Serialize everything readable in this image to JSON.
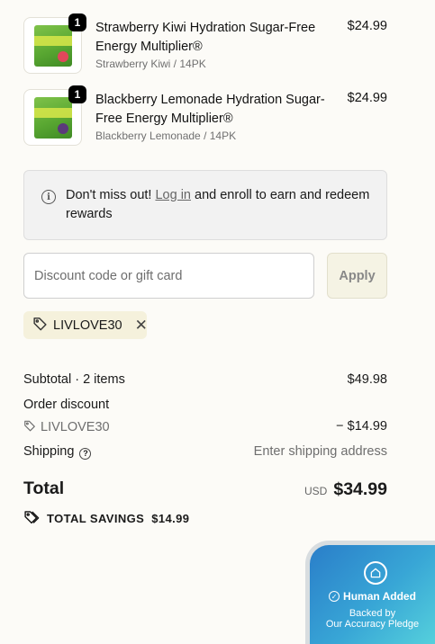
{
  "cart_items": [
    {
      "quantity": "1",
      "name": "Strawberry Kiwi Hydration Sugar-Free Energy Multiplier®",
      "variant": "Strawberry Kiwi / 14PK",
      "price": "$24.99",
      "fruit_color": "#e0475b"
    },
    {
      "quantity": "1",
      "name": "Blackberry Lemonade Hydration Sugar-Free Energy Multiplier®",
      "variant": "Blackberry Lemonade / 14PK",
      "price": "$24.99",
      "fruit_color": "#5b3a7a"
    }
  ],
  "notice": {
    "before": "Don't miss out! ",
    "link": "Log in",
    "after": " and enroll to earn and redeem rewards"
  },
  "discount": {
    "placeholder": "Discount code or gift card",
    "apply_label": "Apply",
    "applied_code": "LIVLOVE30"
  },
  "summary": {
    "subtotal_label": "Subtotal · 2 items",
    "subtotal_value": "$49.98",
    "order_discount_label": "Order discount",
    "discount_code": "LIVLOVE30",
    "discount_value": "− $14.99",
    "shipping_label": "Shipping",
    "shipping_value": "Enter shipping address",
    "total_label": "Total",
    "currency": "USD",
    "total_value": "$34.99",
    "savings_label": "TOTAL SAVINGS",
    "savings_value": "$14.99"
  },
  "badge": {
    "headline": "Human Added",
    "line1": "Backed by",
    "line2": "Our Accuracy Pledge"
  },
  "colors": {
    "page_bg": "#fcfbf7",
    "chip_bg": "#f5f1dc",
    "apply_bg": "#f5f3e4",
    "badge_gradient_start": "#2a7ec9",
    "badge_gradient_end": "#55d0dc"
  }
}
